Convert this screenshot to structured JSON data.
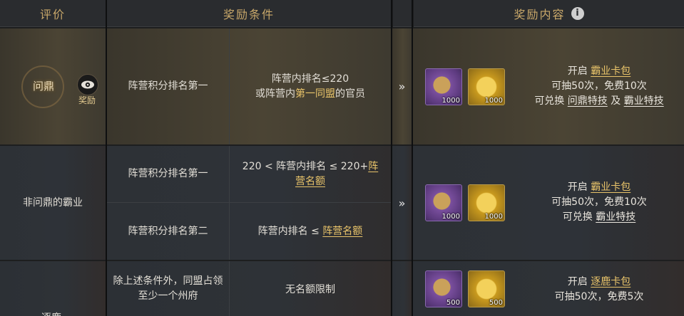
{
  "header": {
    "evaluation": "评价",
    "conditions": "奖励条件",
    "rewards": "奖励内容",
    "info_icon": "i"
  },
  "row1": {
    "rank": "问鼎",
    "view_reward": "奖励",
    "condition_a": "阵营积分排名第一",
    "condition_b_line1": "阵营内排名≤220",
    "condition_b_line2_pre": "或阵营内",
    "condition_b_line2_hl": "第一同盟",
    "condition_b_line2_post": "的官员",
    "arrow": "»",
    "items": [
      {
        "icon": "purple-orb-item-icon",
        "qty": "1000"
      },
      {
        "icon": "gold-coin-item-icon",
        "qty": "1000"
      }
    ],
    "reward_open": "开启",
    "reward_pack": "霸业卡包",
    "reward_draws": "可抽50次，免费10次",
    "reward_exchange_pre": "可兑换",
    "reward_exchange_a": "问鼎特技",
    "reward_exchange_mid": "及",
    "reward_exchange_b": "霸业特技"
  },
  "row2": {
    "rank": "非问鼎的霸业",
    "sub1_condition_a": "阵营积分排名第一",
    "sub1_condition_b_line1_pre": "220 < 阵营内排名 ≤ 220+",
    "sub1_condition_b_line1_hl": "阵",
    "sub1_condition_b_line2_hl": "营名额",
    "sub2_condition_a": "阵营积分排名第二",
    "sub2_condition_b_pre": "阵营内排名 ≤",
    "sub2_condition_b_hl": "阵营名额",
    "arrow": "»",
    "items": [
      {
        "icon": "purple-orb-item-icon",
        "qty": "1000"
      },
      {
        "icon": "gold-coin-item-icon",
        "qty": "1000"
      }
    ],
    "reward_open": "开启",
    "reward_pack": "霸业卡包",
    "reward_draws": "可抽50次，免费10次",
    "reward_exchange_pre": "可兑换",
    "reward_exchange_a": "霸业特技"
  },
  "row3": {
    "rank": "逐鹿",
    "condition_a_line1": "除上述条件外，同盟占领",
    "condition_a_line2": "至少一个州府",
    "condition_b": "无名额限制",
    "items": [
      {
        "icon": "purple-orb-item-icon",
        "qty": "500"
      },
      {
        "icon": "gold-coin-item-icon",
        "qty": "500"
      }
    ],
    "reward_open": "开启",
    "reward_pack": "逐鹿卡包",
    "reward_draws": "可抽50次，免费5次"
  }
}
